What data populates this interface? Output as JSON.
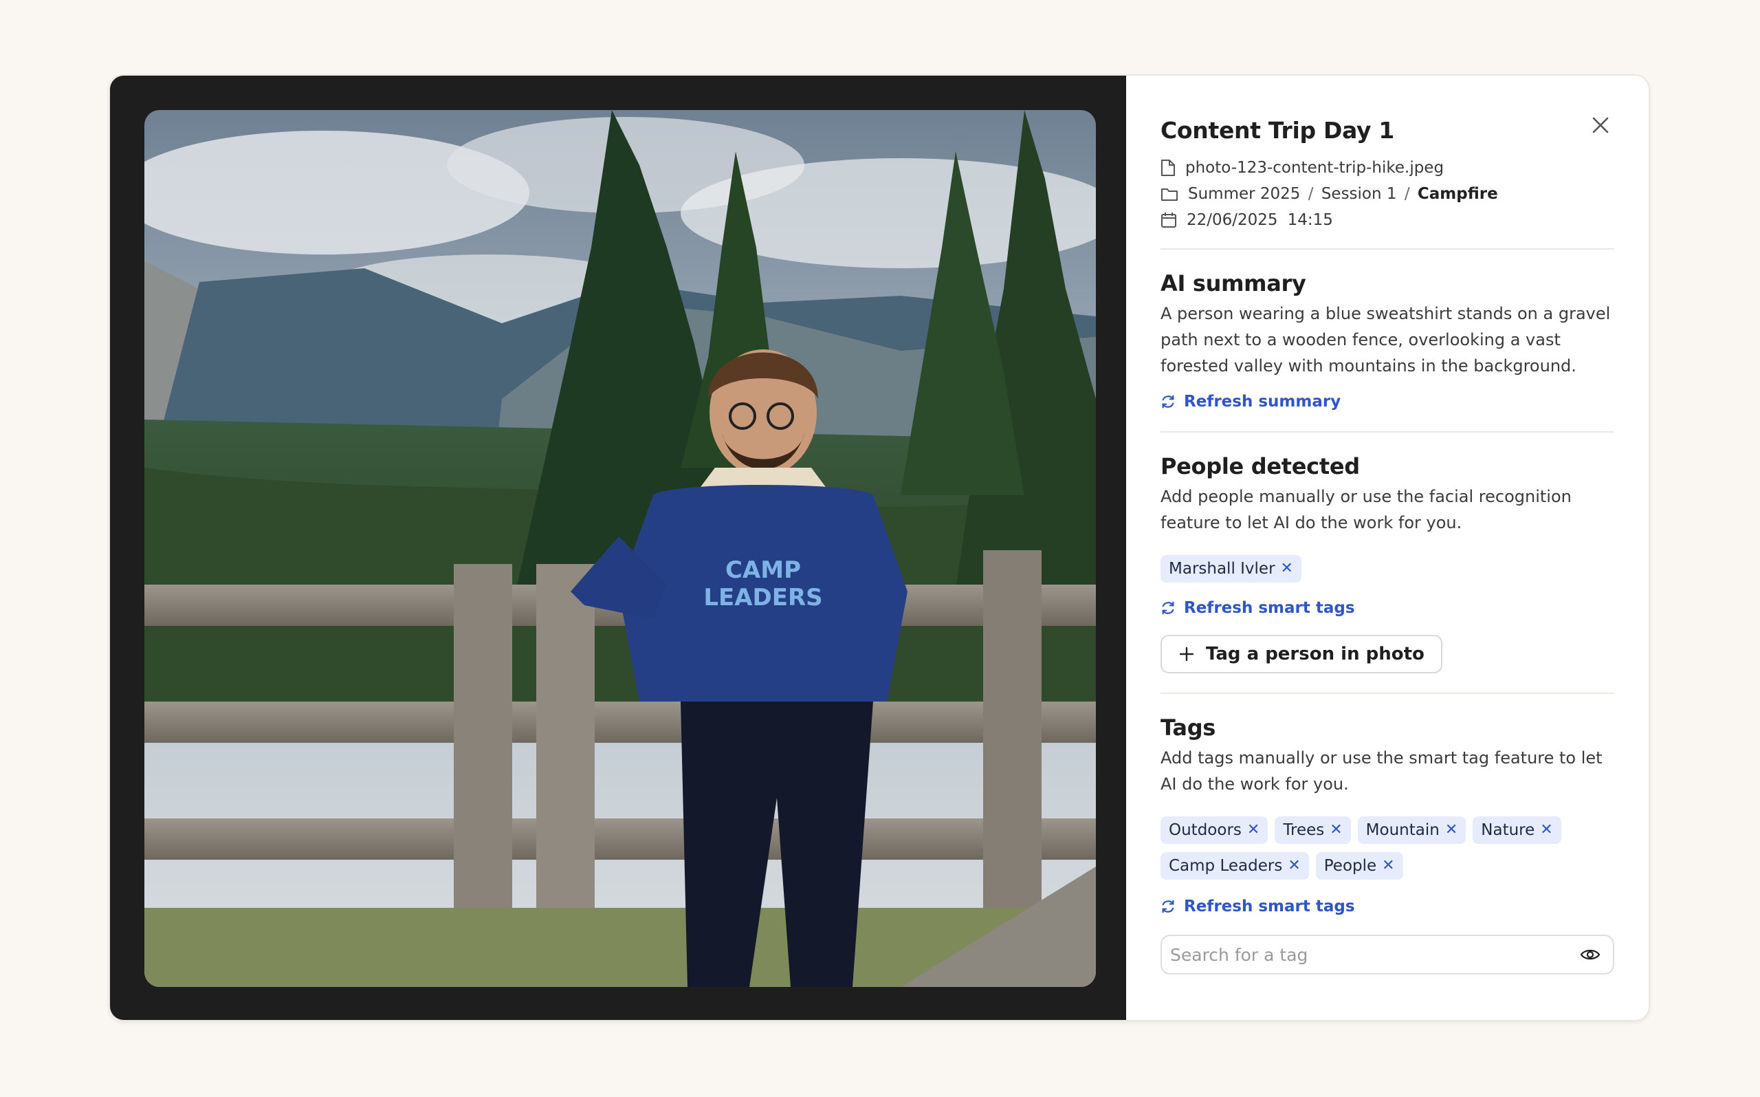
{
  "panel": {
    "title": "Content Trip Day 1",
    "filename": "photo-123-content-trip-hike.jpeg",
    "breadcrumb": [
      "Summer 2025",
      "Session 1",
      "Campfire"
    ],
    "breadcrumb_sep": "/",
    "date": "22/06/2025",
    "time": "14:15"
  },
  "ai_summary": {
    "heading": "AI summary",
    "text": "A person wearing a blue sweatshirt stands on a gravel path next to a wooden fence, overlooking a vast forested valley with mountains in the background.",
    "refresh_label": "Refresh summary"
  },
  "people": {
    "heading": "People detected",
    "text": "Add people manually or use the facial recognition feature to let AI do the work for you.",
    "chips": [
      "Marshall Ivler"
    ],
    "refresh_label": "Refresh smart tags",
    "tag_button_label": "Tag a person in photo"
  },
  "tags": {
    "heading": "Tags",
    "text": "Add tags manually or use the smart tag feature to let AI do the work for you.",
    "chips": [
      "Outdoors",
      "Trees",
      "Mountain",
      "Nature",
      "Camp Leaders",
      "People"
    ],
    "refresh_label": "Refresh smart tags",
    "search_placeholder": "Search for a tag"
  },
  "photo": {
    "sweatshirt_text_1": "CAMP",
    "sweatshirt_text_2": "LEADERS"
  },
  "colors": {
    "accent": "#2f55c7",
    "chip_bg": "#e6ecfb",
    "photo_frame": "#1e1e1e"
  },
  "icons": {
    "close": "close-icon",
    "file": "file-icon",
    "folder": "folder-icon",
    "calendar": "calendar-icon",
    "refresh": "refresh-icon",
    "plus": "plus-icon",
    "eye": "eye-icon"
  }
}
